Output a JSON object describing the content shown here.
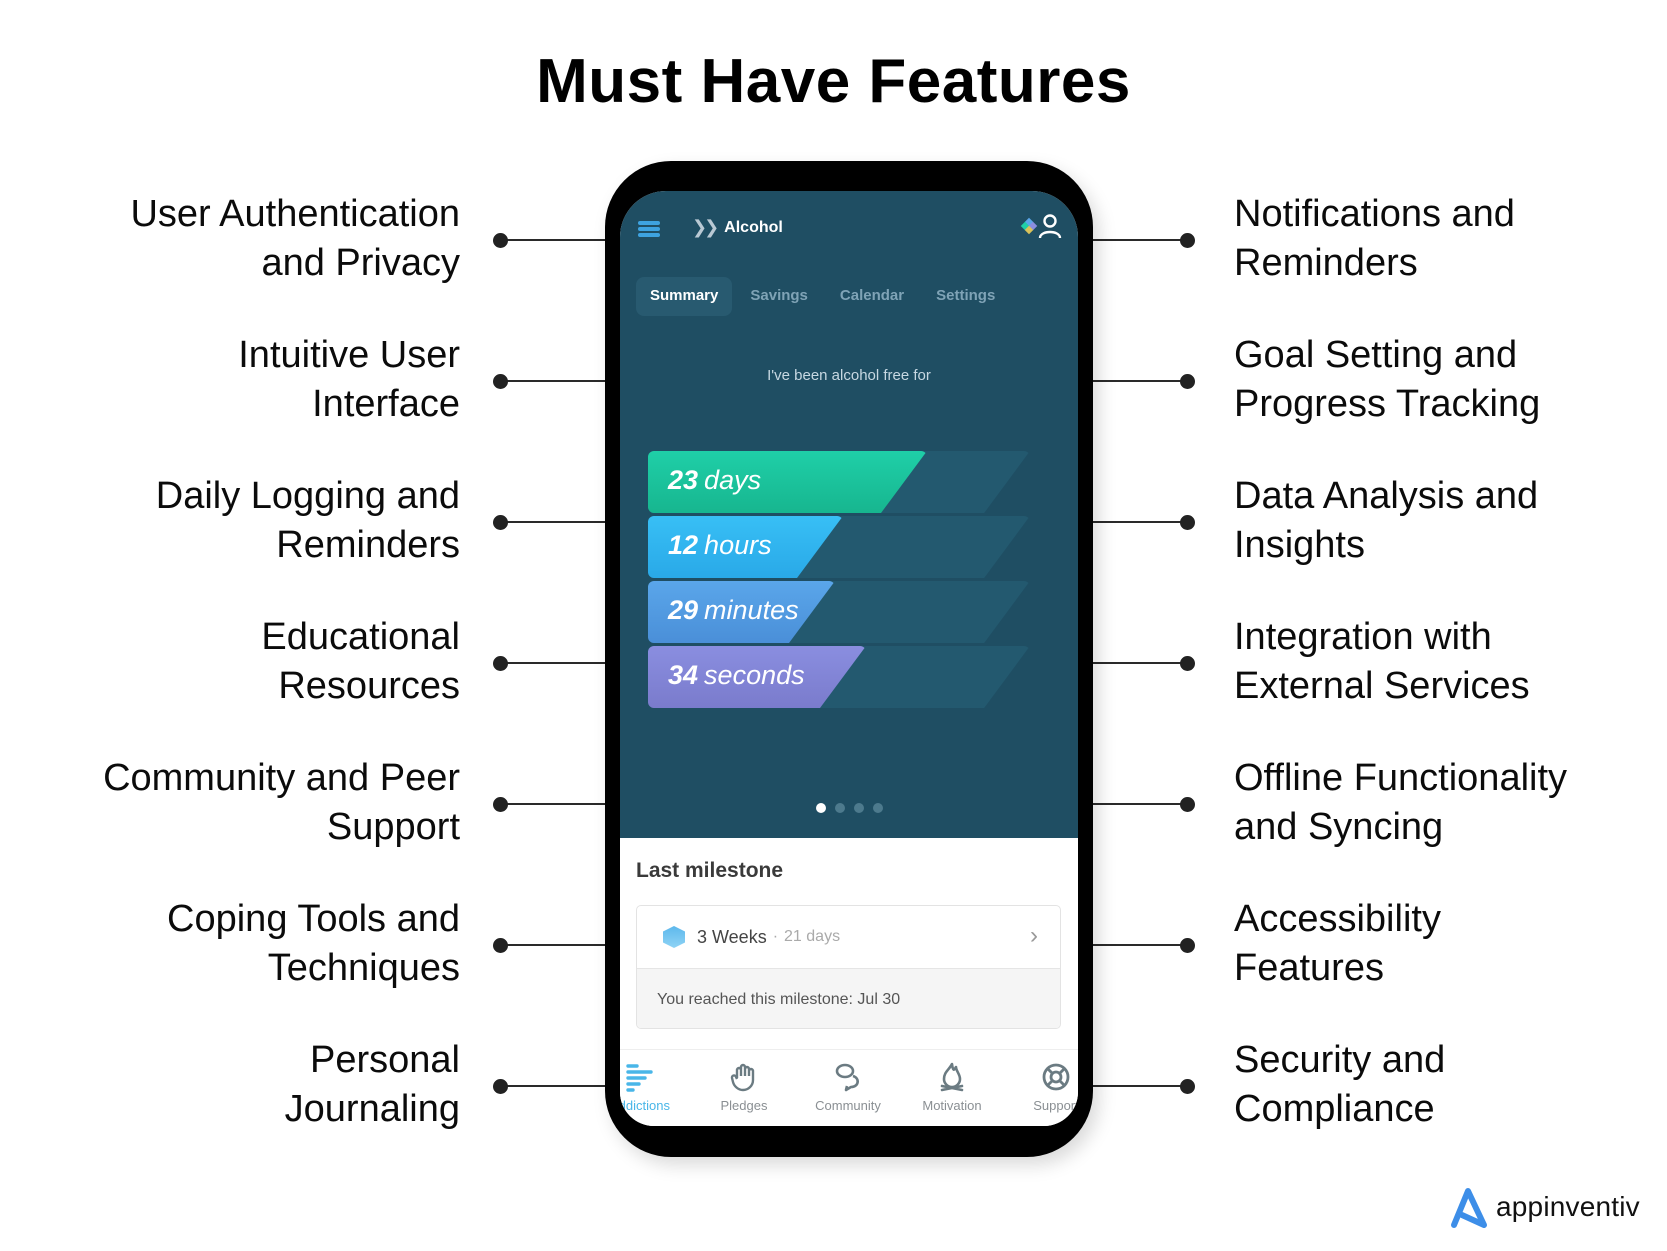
{
  "title": "Must Have Features",
  "features_left": [
    {
      "line1": "User Authentication",
      "line2": "and Privacy"
    },
    {
      "line1": "Intuitive User",
      "line2": "Interface"
    },
    {
      "line1": "Daily Logging and",
      "line2": "Reminders"
    },
    {
      "line1": "Educational",
      "line2": "Resources"
    },
    {
      "line1": "Community and Peer",
      "line2": "Support"
    },
    {
      "line1": "Coping Tools and",
      "line2": "Techniques"
    },
    {
      "line1": "Personal",
      "line2": "Journaling"
    }
  ],
  "features_right": [
    {
      "line1": "Notifications and",
      "line2": "Reminders"
    },
    {
      "line1": "Goal Setting and",
      "line2": "Progress Tracking"
    },
    {
      "line1": "Data Analysis and",
      "line2": "Insights"
    },
    {
      "line1": "Integration with",
      "line2": "External Services"
    },
    {
      "line1": "Offline Functionality",
      "line2": "and Syncing"
    },
    {
      "line1": "Accessibility",
      "line2": "Features"
    },
    {
      "line1": "Security and",
      "line2": "Compliance"
    }
  ],
  "app": {
    "header": {
      "crumb_icon": "double-chevron-right-icon",
      "title": "Alcohol"
    },
    "tabs": [
      {
        "label": "Summary",
        "active": true
      },
      {
        "label": "Savings",
        "active": false
      },
      {
        "label": "Calendar",
        "active": false
      },
      {
        "label": "Settings",
        "active": false
      }
    ],
    "tagline": "I've been alcohol free for",
    "counters": [
      {
        "value": "23",
        "unit": "days",
        "fill_fraction": 0.73,
        "color_from": "#1fcfa8",
        "color_to": "#17b68f"
      },
      {
        "value": "12",
        "unit": "hours",
        "fill_fraction": 0.51,
        "color_from": "#38bff5",
        "color_to": "#29a9e8"
      },
      {
        "value": "29",
        "unit": "minutes",
        "fill_fraction": 0.49,
        "color_from": "#5aa6ea",
        "color_to": "#4a8fd8"
      },
      {
        "value": "34",
        "unit": "seconds",
        "fill_fraction": 0.57,
        "color_from": "#8a8ee0",
        "color_to": "#7a7bcc"
      }
    ],
    "pager": {
      "total": 4,
      "active_index": 0
    },
    "milestone": {
      "section_title": "Last milestone",
      "name": "3 Weeks",
      "separator": "·",
      "days": "21 days",
      "reached_text": "You reached this milestone: Jul 30"
    },
    "bottom_nav": [
      {
        "label": "Addictions",
        "icon": "bars-icon",
        "active": true
      },
      {
        "label": "Pledges",
        "icon": "hand-icon",
        "active": false
      },
      {
        "label": "Community",
        "icon": "chat-bubbles-icon",
        "active": false
      },
      {
        "label": "Motivation",
        "icon": "flame-icon",
        "active": false
      },
      {
        "label": "Support",
        "icon": "lifebuoy-icon",
        "active": false
      }
    ]
  },
  "brand": {
    "name": "appinventiv",
    "color": "#3d8ee8"
  }
}
